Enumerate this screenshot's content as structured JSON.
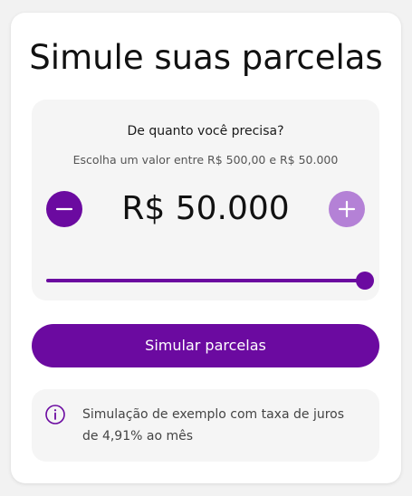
{
  "title": "Simule suas parcelas",
  "amount_panel": {
    "question": "De quanto você precisa?",
    "range_hint": "Escolha um valor entre R$ 500,00 e R$ 50.000",
    "amount": "R$ 50.000",
    "decrease_icon": "minus-icon",
    "increase_icon": "plus-icon",
    "slider_value": 50000,
    "slider_min": 500,
    "slider_max": 50000
  },
  "simulate_button_label": "Simular parcelas",
  "info": {
    "icon": "info-icon",
    "text": "Simulação de exemplo com taxa de juros de 4,91% ao mês"
  },
  "colors": {
    "brand": "#6b0aa0",
    "brand_light": "#b481d6",
    "panel_bg": "#f5f5f5",
    "card_bg": "#ffffff"
  }
}
